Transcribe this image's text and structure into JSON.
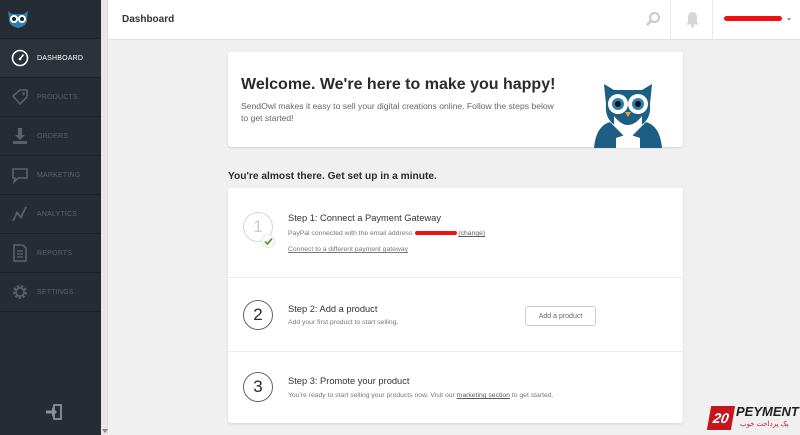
{
  "colors": {
    "sidebar_bg": "#262c33",
    "accent_red": "#ee1111",
    "check_green": "#5aa02c",
    "owl_blue": "#1d5e84"
  },
  "header": {
    "title": "Dashboard"
  },
  "sidebar": {
    "logo_icon": "owl-logo-icon",
    "items": [
      {
        "label": "DASHBOARD",
        "icon": "speedometer-icon",
        "active": true
      },
      {
        "label": "PRODUCTS",
        "icon": "tag-icon"
      },
      {
        "label": "ORDERS",
        "icon": "download-icon"
      },
      {
        "label": "MARKETING",
        "icon": "speech-bubble-icon"
      },
      {
        "label": "ANALYTICS",
        "icon": "line-graph-icon"
      },
      {
        "label": "REPORTS",
        "icon": "document-icon"
      },
      {
        "label": "SETTINGS",
        "icon": "gear-icon"
      }
    ],
    "logout_icon": "logout-icon"
  },
  "welcome": {
    "title": "Welcome. We're here to make you happy!",
    "text": "SendOwl makes it easy to sell your digital creations online. Follow the steps below to get started!"
  },
  "setup": {
    "title": "You're almost there. Get set up in a minute.",
    "steps": [
      {
        "number": "1",
        "title": "Step 1: Connect a Payment Gateway",
        "text": "PayPal connected with the email address",
        "change_link": "(change)",
        "second_link": "Connect to a different payment gateway",
        "completed": true
      },
      {
        "number": "2",
        "title": "Step 2: Add a product",
        "text": "Add your first product to start selling.",
        "button": "Add a product"
      },
      {
        "number": "3",
        "title": "Step 3: Promote your product",
        "text_before": "You're ready to start selling your products now. Visit our",
        "link": "marketing section",
        "text_after": "to get started."
      }
    ]
  },
  "watermark": {
    "number": "20",
    "brand": "PEYMENT",
    "subtitle": "پک پرداخت خوب"
  }
}
